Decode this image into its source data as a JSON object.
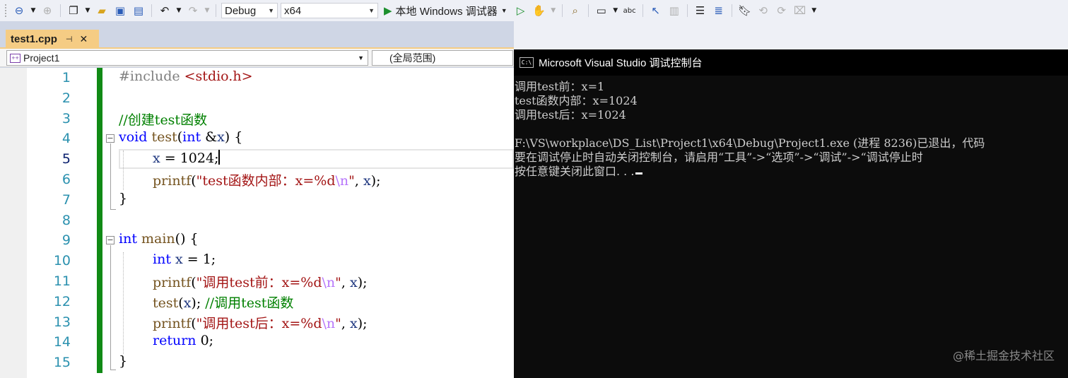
{
  "toolbar": {
    "config_select": "Debug",
    "platform_select": "x64",
    "run_label": "本地 Windows 调试器",
    "spell_icon_label": "abc"
  },
  "tab": {
    "name": "test1.cpp",
    "pin": "⊣",
    "close": "✕"
  },
  "navbar": {
    "project": "Project1",
    "scope": "(全局范围)"
  },
  "editor": {
    "current_line": 5,
    "lines": [
      {
        "n": "1"
      },
      {
        "n": "2"
      },
      {
        "n": "3"
      },
      {
        "n": "4"
      },
      {
        "n": "5"
      },
      {
        "n": "6"
      },
      {
        "n": "7"
      },
      {
        "n": "8"
      },
      {
        "n": "9"
      },
      {
        "n": "10"
      },
      {
        "n": "11"
      },
      {
        "n": "12"
      },
      {
        "n": "13"
      },
      {
        "n": "14"
      },
      {
        "n": "15"
      }
    ],
    "code": {
      "l1_pp": "#include ",
      "l1_inc": "<stdio.h>",
      "l3_cm": "//创建test函数",
      "l4_kw": "void",
      "l4_fn": " test",
      "l4_open": "(",
      "l4_kw2": "int",
      "l4_amp": " &",
      "l4_par": "x",
      "l4_close": ") {",
      "l5_par": "x",
      "l5_rest": " = 1024;",
      "l6_fn": "printf",
      "l6_open": "(",
      "l6_st": "\"test函数内部：x=%d",
      "l6_es": "\\n",
      "l6_st2": "\"",
      "l6_rest": ", ",
      "l6_par": "x",
      "l6_end": ");",
      "l7": "}",
      "l9_kw": "int",
      "l9_fn": " main",
      "l9_rest": "() {",
      "l10_kw": "int",
      "l10_var": " x",
      "l10_rest": " = 1;",
      "l11_fn": "printf",
      "l11_open": "(",
      "l11_st": "\"调用test前：x=%d",
      "l11_es": "\\n",
      "l11_st2": "\"",
      "l11_rest": ", ",
      "l11_par": "x",
      "l11_end": ");",
      "l12_fn": "test",
      "l12_open": "(",
      "l12_par": "x",
      "l12_close": "); ",
      "l12_cm": "//调用test函数",
      "l13_fn": "printf",
      "l13_open": "(",
      "l13_st": "\"调用test后：x=%d",
      "l13_es": "\\n",
      "l13_st2": "\"",
      "l13_rest": ", ",
      "l13_par": "x",
      "l13_end": ");",
      "l14_kw": "return",
      "l14_rest": " 0;",
      "l15": "}"
    }
  },
  "console": {
    "title": "Microsoft Visual Studio 调试控制台",
    "icon_label": "C:\\",
    "lines": [
      "调用test前：x=1",
      "test函数内部：x=1024",
      "调用test后：x=1024",
      "",
      "F:\\VS\\workplace\\DS_List\\Project1\\x64\\Debug\\Project1.exe (进程 8236)已退出，代码",
      "要在调试停止时自动关闭控制台，请启用“工具”->“选项”->“调试”->“调试停止时",
      "按任意键关闭此窗口. . ."
    ],
    "watermark": "@稀土掘金技术社区"
  }
}
